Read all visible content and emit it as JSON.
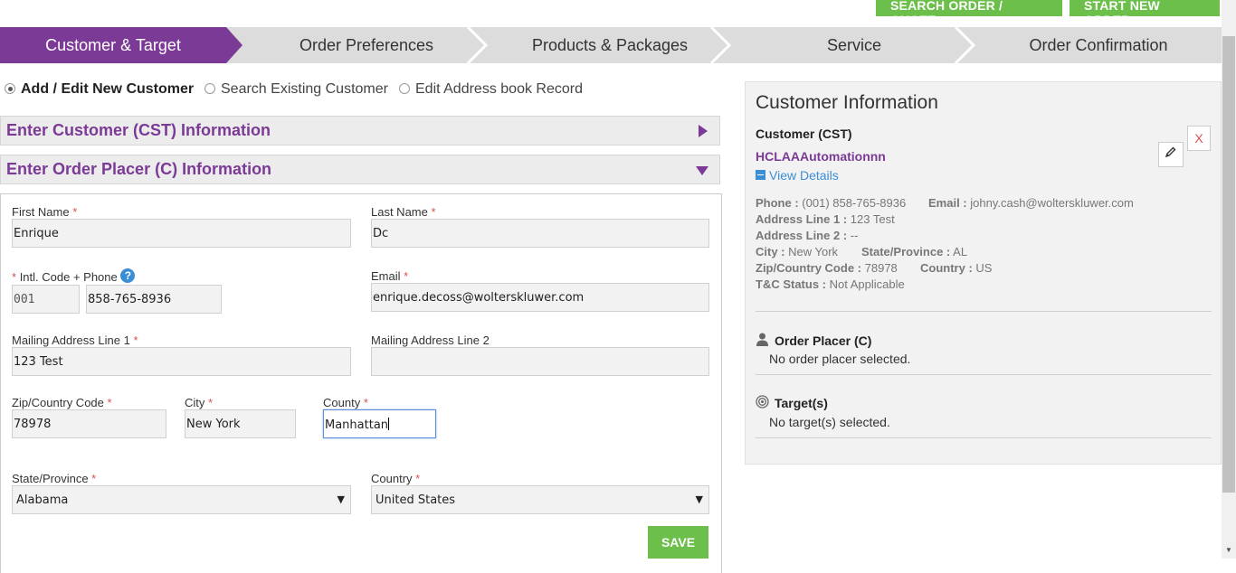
{
  "top_buttons": {
    "search": "SEARCH ORDER / QUOTE",
    "start": "START NEW ORDER"
  },
  "steps": [
    {
      "label": "Customer & Target",
      "active": true
    },
    {
      "label": "Order Preferences",
      "active": false
    },
    {
      "label": "Products & Packages",
      "active": false
    },
    {
      "label": "Service",
      "active": false
    },
    {
      "label": "Order Confirmation",
      "active": false
    }
  ],
  "mode": {
    "options": [
      "Add / Edit New Customer",
      "Search Existing Customer",
      "Edit Address book Record"
    ],
    "selected": "Add / Edit New Customer"
  },
  "sections": {
    "cst": "Enter Customer (CST) Information",
    "order_placer": "Enter Order Placer (C) Information"
  },
  "form": {
    "first_name": {
      "label": "First Name",
      "value": "Enrique"
    },
    "last_name": {
      "label": "Last Name",
      "value": "Dc"
    },
    "phone": {
      "label": "Intl. Code + Phone",
      "code": "001",
      "number": "858-765-8936"
    },
    "email": {
      "label": "Email",
      "value": "enrique.decoss@wolterskluwer.com"
    },
    "address1": {
      "label": "Mailing Address Line 1",
      "value": "123 Test"
    },
    "address2": {
      "label": "Mailing Address Line 2",
      "value": ""
    },
    "zip": {
      "label": "Zip/Country Code",
      "value": "78978"
    },
    "city": {
      "label": "City",
      "value": "New York"
    },
    "county": {
      "label": "County",
      "value": "Manhattan"
    },
    "state": {
      "label": "State/Province",
      "value": "Alabama"
    },
    "country": {
      "label": "Country",
      "value": "United States"
    },
    "save_label": "SAVE",
    "required_mark": "*"
  },
  "customer_info": {
    "title": "Customer Information",
    "cst_heading": "Customer (CST)",
    "cst_name": "HCLAAAutomationnn",
    "view_details": "View Details",
    "remove_label": "X",
    "details": {
      "phone": {
        "label": "Phone :",
        "value": "(001) 858-765-8936"
      },
      "email": {
        "label": "Email :",
        "value": "johny.cash@wolterskluwer.com"
      },
      "address1": {
        "label": "Address Line 1 :",
        "value": "123 Test"
      },
      "address2": {
        "label": "Address Line 2 :",
        "value": "--"
      },
      "city": {
        "label": "City :",
        "value": "New York"
      },
      "state": {
        "label": "State/Province :",
        "value": "AL"
      },
      "zip": {
        "label": "Zip/Country Code :",
        "value": "78978"
      },
      "country": {
        "label": "Country :",
        "value": "US"
      },
      "tc_status": {
        "label": "T&C Status :",
        "value": "Not Applicable"
      }
    },
    "order_placer": {
      "heading": "Order Placer (C)",
      "empty": "No order placer selected."
    },
    "targets": {
      "heading": "Target(s)",
      "empty": "No target(s) selected."
    }
  },
  "colors": {
    "brand_purple": "#7b3a96",
    "action_green": "#6cbf4a",
    "link_blue": "#3a8ed6",
    "required_red": "#d9534f"
  }
}
